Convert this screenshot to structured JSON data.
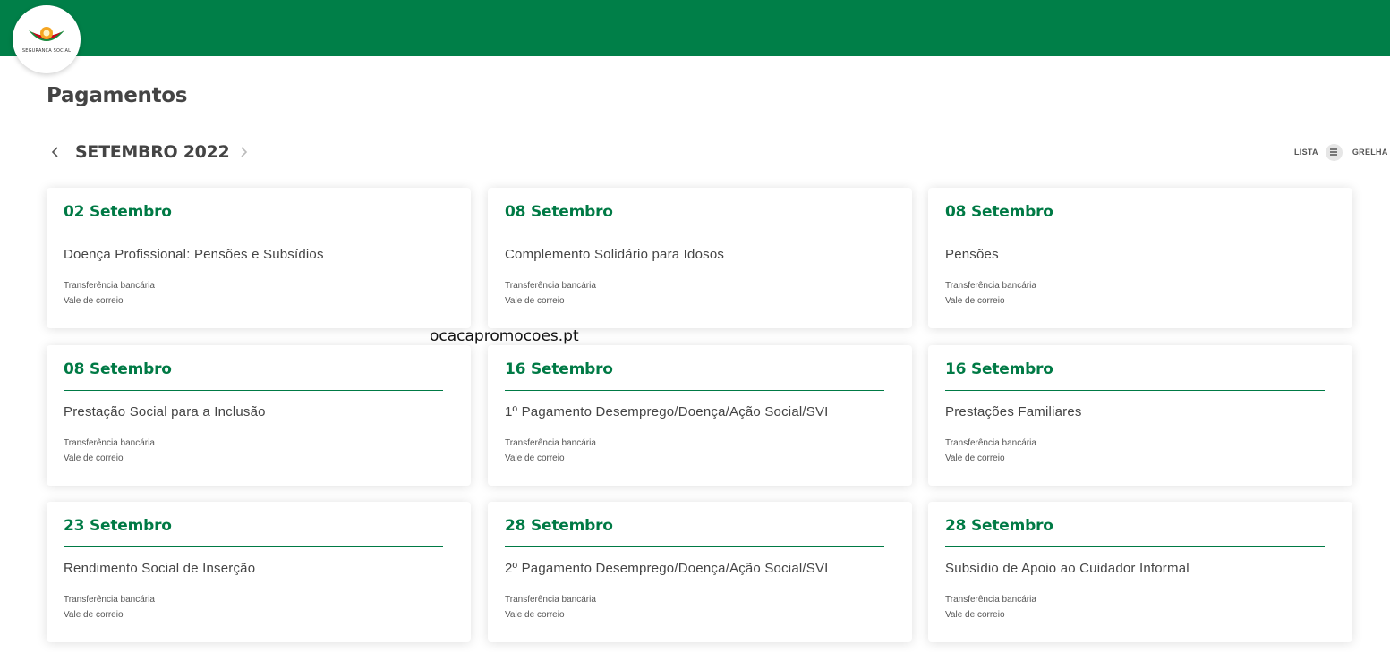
{
  "header": {
    "brand_text": "SEGURANÇA SOCIAL",
    "colors": {
      "brand_green": "#007f48",
      "accent_orange": "#f5a623",
      "accent_red": "#d0021b"
    }
  },
  "page": {
    "title": "Pagamentos"
  },
  "calendar": {
    "month_label": "SETEMBRO 2022",
    "prev_icon": "chevron-left-icon",
    "next_icon": "chevron-right-icon"
  },
  "view_toggle": {
    "list_label": "LISTA",
    "grid_label": "GRELHA"
  },
  "payments": [
    {
      "date": "02 Setembro",
      "title": "Doença Profissional: Pensões e Subsídios",
      "methods": [
        "Transferência bancária",
        "Vale de correio"
      ]
    },
    {
      "date": "08 Setembro",
      "title": "Complemento Solidário para Idosos",
      "methods": [
        "Transferência bancária",
        "Vale de correio"
      ]
    },
    {
      "date": "08 Setembro",
      "title": "Pensões",
      "methods": [
        "Transferência bancária",
        "Vale de correio"
      ]
    },
    {
      "date": "08 Setembro",
      "title": "Prestação Social para a Inclusão",
      "methods": [
        "Transferência bancária",
        "Vale de correio"
      ]
    },
    {
      "date": "16 Setembro",
      "title": "1º Pagamento Desemprego/Doença/Ação Social/SVI",
      "methods": [
        "Transferência bancária",
        "Vale de correio"
      ]
    },
    {
      "date": "16 Setembro",
      "title": "Prestações Familiares",
      "methods": [
        "Transferência bancária",
        "Vale de correio"
      ]
    },
    {
      "date": "23 Setembro",
      "title": "Rendimento Social de Inserção",
      "methods": [
        "Transferência bancária",
        "Vale de correio"
      ]
    },
    {
      "date": "28 Setembro",
      "title": "2º Pagamento Desemprego/Doença/Ação Social/SVI",
      "methods": [
        "Transferência bancária",
        "Vale de correio"
      ]
    },
    {
      "date": "28 Setembro",
      "title": "Subsídio de Apoio ao Cuidador Informal",
      "methods": [
        "Transferência bancária",
        "Vale de correio"
      ]
    }
  ],
  "watermark": "ocacapromocoes.pt"
}
